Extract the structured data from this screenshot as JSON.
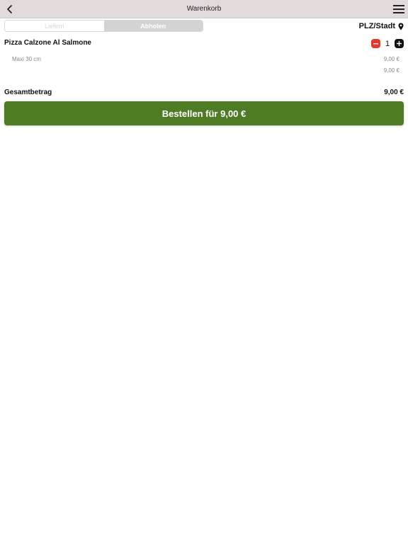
{
  "header": {
    "title": "Warenkorb",
    "back_icon": "chevron-left-icon",
    "menu_icon": "hamburger-menu-icon"
  },
  "delivery_mode": {
    "options": [
      "Liefern",
      "Abholen"
    ],
    "selected": "Abholen"
  },
  "location": {
    "label": "PLZ/Stadt",
    "icon": "map-pin-icon"
  },
  "cart": {
    "items": [
      {
        "name": "Pizza Calzone Al Salmone",
        "quantity": "1",
        "variant": "Maxi 30 cm",
        "variant_price": "9,00 €",
        "item_total": "9,00 €"
      }
    ],
    "total_label": "Gesamtbetrag",
    "total_value": "9,00 €"
  },
  "order_button": {
    "label": "Bestellen für 9,00 €"
  },
  "colors": {
    "header_bg": "#e2dbdc",
    "order_button": "#4f7b25",
    "minus_button": "#e03a2a",
    "plus_button": "#111111"
  }
}
